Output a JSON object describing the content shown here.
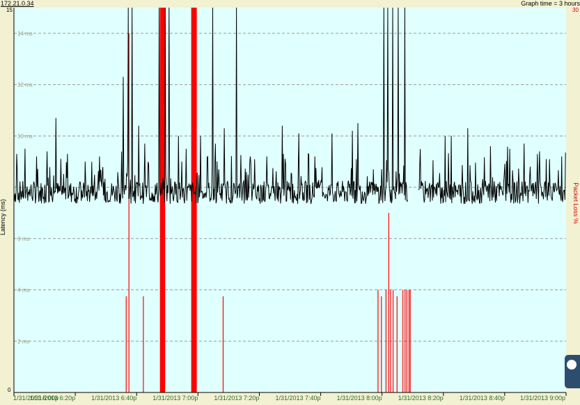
{
  "header": {
    "host": "172.21.0.34",
    "graph_time": "Graph time = 3 hours"
  },
  "chart_data": {
    "type": "line",
    "title": "",
    "ylabel": "Latency (ms)",
    "y2label": "Packet Loss %",
    "ylim": [
      0,
      15
    ],
    "y2lim": [
      0,
      30
    ],
    "y_max_label": "15",
    "y_zero_label": "0",
    "y2_max_label": "30",
    "y_tick_labels": [
      {
        "value": 14,
        "label": "14 ms"
      },
      {
        "value": 12,
        "label": "12 ms"
      },
      {
        "value": 10,
        "label": "10 ms"
      },
      {
        "value": 6,
        "label": "6 ms"
      },
      {
        "value": 4,
        "label": "4 ms"
      },
      {
        "value": 2,
        "label": "2 ms"
      }
    ],
    "x_tick_labels": [
      "1/31/2013 6:00p",
      "1/31/2013 6:20p",
      "1/31/2013 6:40p",
      "1/31/2013 7:00p",
      "1/31/2013 7:20p",
      "1/31/2013 7:40p",
      "1/31/2013 8:00p",
      "1/31/2013 8:20p",
      "1/31/2013 8:40p",
      "1/31/2013 9:00p"
    ],
    "x_range_minutes": [
      0,
      180
    ],
    "grid": true,
    "colors": {
      "plot_bg": "#e0ffff",
      "latency_line": "#000000",
      "loss_line": "#ff0000",
      "grid": "#9a9a9a",
      "axis_label": "#9c9c78",
      "x_label": "#2e6b2e",
      "loss_text": "#dd0000"
    },
    "latency_baseline_ms": 7.6,
    "latency_spikes": [
      {
        "t": 0.9,
        "v": 9.3
      },
      {
        "t": 3.6,
        "v": 9.5
      },
      {
        "t": 7.3,
        "v": 9.2
      },
      {
        "t": 10.8,
        "v": 9.4
      },
      {
        "t": 13.7,
        "v": 10.7
      },
      {
        "t": 17.4,
        "v": 9.3
      },
      {
        "t": 23.3,
        "v": 9.0
      },
      {
        "t": 27.9,
        "v": 9.2
      },
      {
        "t": 35.6,
        "v": 12.3
      },
      {
        "t": 37.3,
        "v": 15.0
      },
      {
        "t": 38.5,
        "v": 15.0
      },
      {
        "t": 40.6,
        "v": 10.4
      },
      {
        "t": 42.7,
        "v": 9.7
      },
      {
        "t": 47.3,
        "v": 15.0
      },
      {
        "t": 49.4,
        "v": 15.0
      },
      {
        "t": 50.6,
        "v": 15.0
      },
      {
        "t": 53.6,
        "v": 10.0
      },
      {
        "t": 56.2,
        "v": 9.5
      },
      {
        "t": 60.8,
        "v": 10.0
      },
      {
        "t": 64.8,
        "v": 15.0
      },
      {
        "t": 65.7,
        "v": 9.7
      },
      {
        "t": 68.6,
        "v": 10.3
      },
      {
        "t": 72.6,
        "v": 15.0
      },
      {
        "t": 77.0,
        "v": 9.2
      },
      {
        "t": 82.5,
        "v": 9.2
      },
      {
        "t": 87.5,
        "v": 10.4
      },
      {
        "t": 92.8,
        "v": 10.1
      },
      {
        "t": 98.1,
        "v": 9.2
      },
      {
        "t": 103.6,
        "v": 10.1
      },
      {
        "t": 110.3,
        "v": 10.2
      },
      {
        "t": 112.2,
        "v": 10.5
      },
      {
        "t": 120.6,
        "v": 15.0
      },
      {
        "t": 121.8,
        "v": 15.0
      },
      {
        "t": 123.5,
        "v": 15.0
      },
      {
        "t": 125.2,
        "v": 15.0
      },
      {
        "t": 127.5,
        "v": 15.0
      },
      {
        "t": 130.3,
        "v": 15.0
      },
      {
        "t": 140.6,
        "v": 10.0
      },
      {
        "t": 142.5,
        "v": 10.0
      },
      {
        "t": 148.0,
        "v": 10.3
      },
      {
        "t": 155.3,
        "v": 9.6
      },
      {
        "t": 161.6,
        "v": 9.5
      },
      {
        "t": 166.3,
        "v": 9.7
      },
      {
        "t": 171.3,
        "v": 9.4
      },
      {
        "t": 178.6,
        "v": 9.2
      }
    ],
    "latency_gap_minutes": [
      128.5,
      131.8
    ],
    "loss_events": [
      {
        "t": 36.6,
        "v": 7.5
      },
      {
        "t": 37.5,
        "v": 28.0
      },
      {
        "t": 42.2,
        "v": 7.5
      },
      {
        "t": 47.6,
        "v": 30.0,
        "width_min": 1.7
      },
      {
        "t": 57.8,
        "v": 30.0,
        "width_min": 1.8
      },
      {
        "t": 68.2,
        "v": 7.5
      },
      {
        "t": 118.7,
        "v": 8.0
      },
      {
        "t": 119.8,
        "v": 7.5
      },
      {
        "t": 121.3,
        "v": 8.0
      },
      {
        "t": 122.2,
        "v": 14.0
      },
      {
        "t": 122.8,
        "v": 8.0
      },
      {
        "t": 123.6,
        "v": 8.0
      },
      {
        "t": 124.9,
        "v": 7.5
      },
      {
        "t": 126.8,
        "v": 8.0
      },
      {
        "t": 127.5,
        "v": 8.0
      },
      {
        "t": 128.1,
        "v": 8.0
      },
      {
        "t": 128.8,
        "v": 8.0
      },
      {
        "t": 129.2,
        "v": 8.0
      }
    ]
  }
}
